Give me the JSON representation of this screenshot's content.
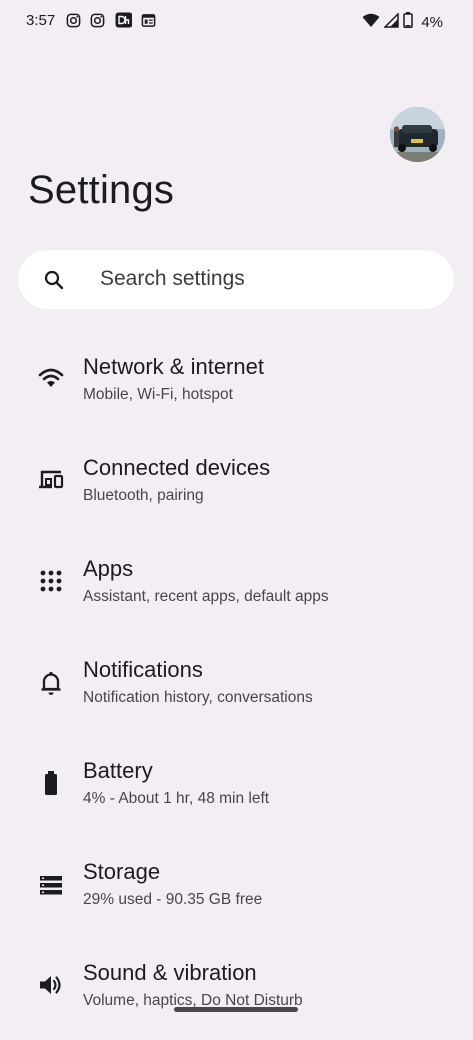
{
  "status_bar": {
    "time": "3:57",
    "battery_percent": "4%",
    "left_icons": [
      "instagram-icon",
      "instagram-icon",
      "dailyhunt-icon",
      "news-icon"
    ],
    "right_icons": [
      "wifi-icon",
      "signal-icon",
      "battery-icon"
    ]
  },
  "header": {
    "title": "Settings"
  },
  "search": {
    "placeholder": "Search settings"
  },
  "items": [
    {
      "title": "Network & internet",
      "subtitle": "Mobile, Wi-Fi, hotspot",
      "icon": "wifi-icon"
    },
    {
      "title": "Connected devices",
      "subtitle": "Bluetooth, pairing",
      "icon": "devices-icon"
    },
    {
      "title": "Apps",
      "subtitle": "Assistant, recent apps, default apps",
      "icon": "apps-grid-icon"
    },
    {
      "title": "Notifications",
      "subtitle": "Notification history, conversations",
      "icon": "bell-icon"
    },
    {
      "title": "Battery",
      "subtitle": "4% - About 1 hr, 48 min left",
      "icon": "battery-icon"
    },
    {
      "title": "Storage",
      "subtitle": "29% used - 90.35 GB free",
      "icon": "storage-icon"
    },
    {
      "title": "Sound & vibration",
      "subtitle": "Volume, haptics, Do Not Disturb",
      "icon": "volume-icon"
    }
  ],
  "colors": {
    "background": "#f3edf4",
    "search_bg": "#ffffff",
    "text_primary": "#1c1b1f",
    "text_secondary": "#49454f"
  }
}
